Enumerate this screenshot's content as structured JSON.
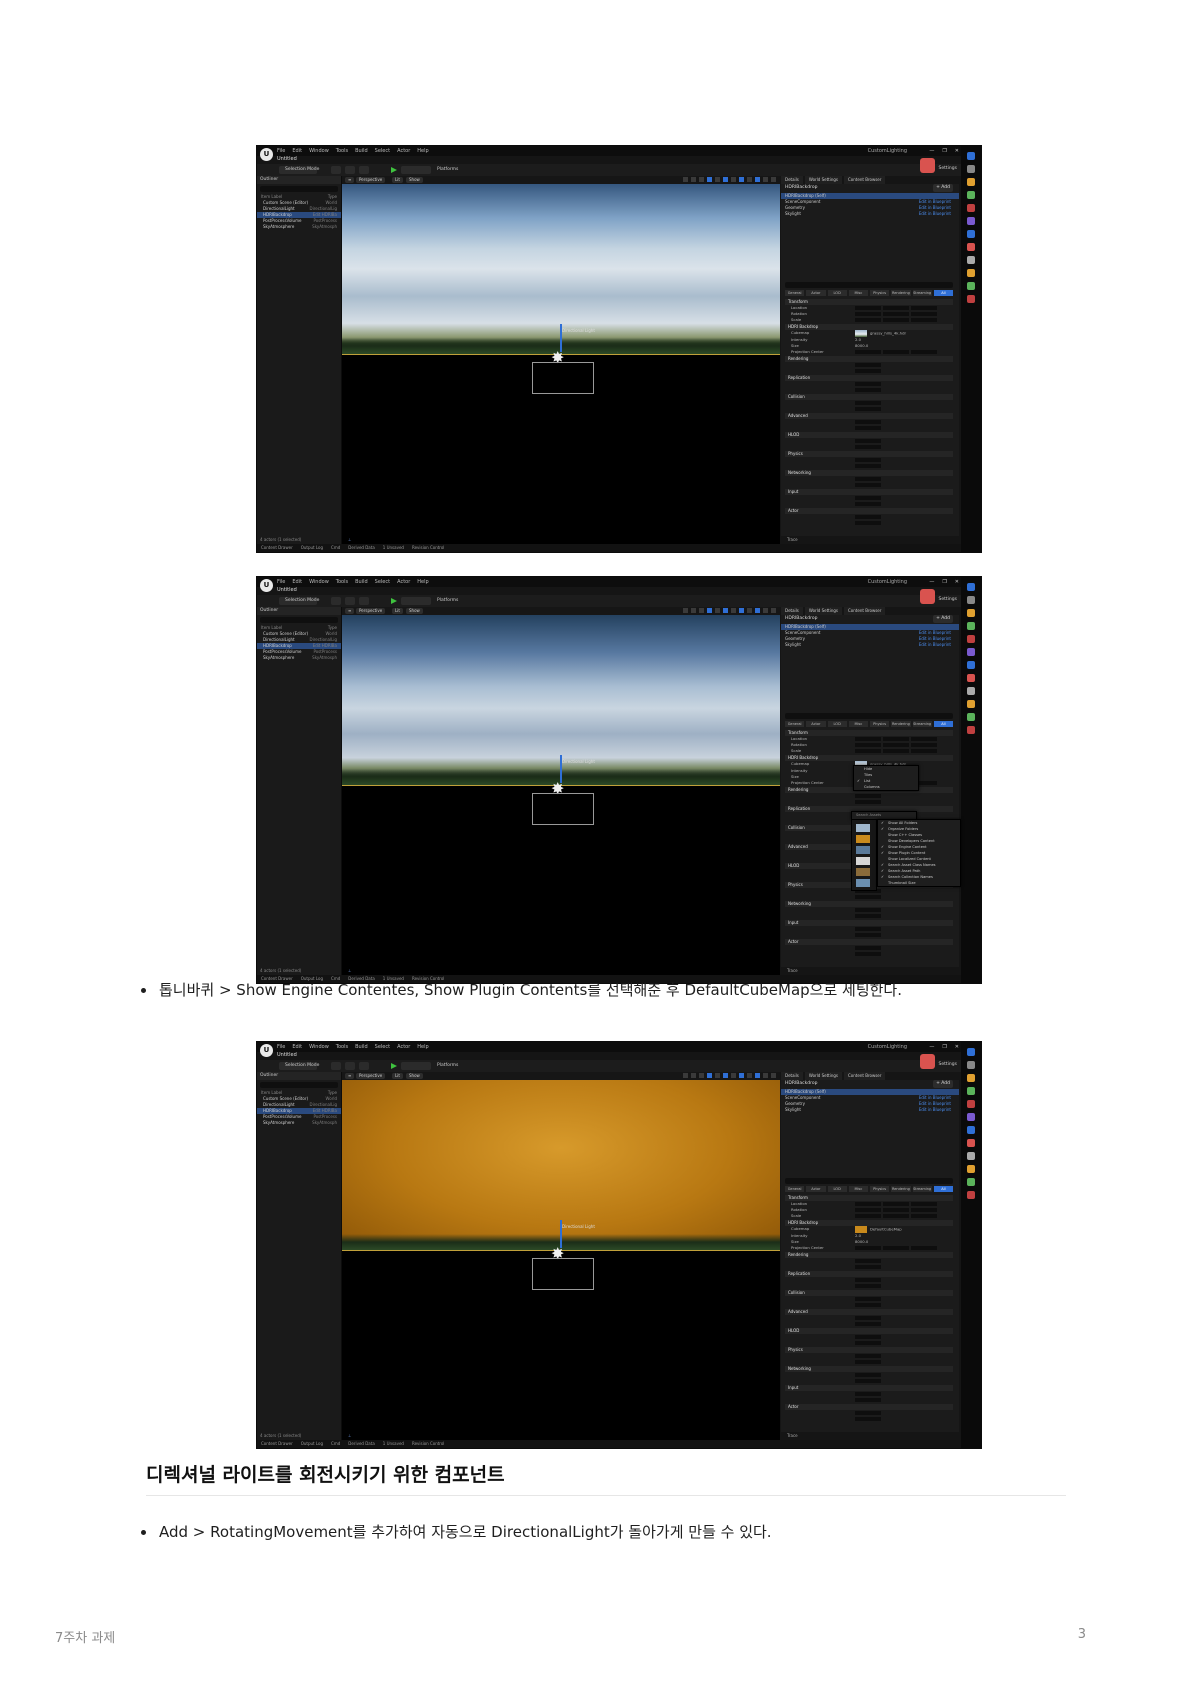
{
  "editor": {
    "menu": [
      "File",
      "Edit",
      "Window",
      "Tools",
      "Build",
      "Select",
      "Actor",
      "Help"
    ],
    "level_name": "Untitled",
    "project_name": "CustomLighting",
    "window_buttons": [
      "—",
      "❐",
      "✕"
    ],
    "toolbar": {
      "selection_mode": "Selection Mode",
      "platforms": "Platforms",
      "settings": "Settings"
    },
    "outliner": {
      "tab": "Outliner",
      "columns": [
        "Item Label",
        "Type"
      ],
      "rows": [
        {
          "label": "Custom Scene (Editor)",
          "type": "World"
        },
        {
          "label": "DirectionalLight",
          "type": "DirectionalLig"
        },
        {
          "label": "HDRIBackdrop",
          "type": "Edit HDRIBa"
        },
        {
          "label": "PostProcessVolume",
          "type": "PostProcess"
        },
        {
          "label": "SkyAtmosphere",
          "type": "SkyAtmosph"
        }
      ],
      "footer": "4 actors (1 selected)"
    },
    "viewport": {
      "perspective": "Perspective",
      "lit": "Lit",
      "show": "Show",
      "gizmo_label": "Directional Light"
    },
    "details": {
      "tabs": [
        "Details",
        "World Settings",
        "Content Browser"
      ],
      "actor": "HDRIBackdrop",
      "add_label": "+ Add",
      "components": [
        {
          "label": "HDRIBackdrop (Self)",
          "edit": ""
        },
        {
          "label": "SceneComponent",
          "edit": "Edit in Blueprint"
        },
        {
          "label": "Geometry",
          "edit": "Edit in Blueprint"
        },
        {
          "label": "Skylight",
          "edit": "Edit in Blueprint"
        }
      ],
      "category_tabs": [
        "General",
        "Actor",
        "LOD",
        "Misc",
        "Physics",
        "Rendering",
        "Streaming",
        "All"
      ],
      "transform": {
        "cat": "Transform",
        "rows": [
          "Location",
          "Rotation",
          "Scale"
        ]
      },
      "hdri": {
        "cat": "HDRI Backdrop",
        "cubemap_label": "Cubemap",
        "cubemap_value_1": "grassy_hills_4k.hdr",
        "cubemap_value_3": "DefaultCubeMap",
        "intensity_label": "Intensity",
        "intensity": "2.0",
        "size_label": "Size",
        "size": "8000.0",
        "projection_center": "Projection Center"
      },
      "sections": [
        "Rendering",
        "Replication",
        "Collision",
        "Advanced",
        "HLOD",
        "Physics",
        "Networking",
        "Input",
        "Actor"
      ],
      "footer": "Trace"
    },
    "status": [
      "Content Drawer",
      "Output Log",
      "Cmd",
      "Derived Data",
      "1 Unsaved",
      "Revision Control"
    ]
  },
  "popup": {
    "filter_menu": [
      "Hide",
      "Tiles",
      "List",
      "Columns"
    ],
    "view_options": [
      "Show All Folders",
      "Organize Folders",
      "Show C++ Classes",
      "Show Developers Content",
      "Show Engine Content",
      "Show Plugin Content",
      "Show Localized Content",
      "Search Asset Class Names",
      "Search Asset Path",
      "Search Collection Names",
      "Thumbnail Size"
    ],
    "checked": [
      "Show All Folders",
      "Organize Folders",
      "Show Engine Content",
      "Show Plugin Content",
      "Search Asset Class Names",
      "Search Asset Path",
      "Search Collection Names"
    ],
    "search_placeholder": "Search Assets"
  },
  "document": {
    "bullet1": "톱니바퀴 > Show Engine Contentes, Show Plugin Contents를 선택해준 후 DefaultCubeMap으로 세팅한다.",
    "heading": "디렉셔널 라이트를 회전시키기 위한 컴포넌트",
    "bullet2": "Add > RotatingMovement를 추가하여 자동으로 DirectionalLight가 돌아가게 만들 수 있다.",
    "footer_left": "7주차 과제",
    "page_number": "3"
  },
  "colors": {
    "selection_blue": "#2a4a7f",
    "accent_blue": "#2f6fd6",
    "play_green": "#3fc33f",
    "cubemap_orange": "#c98a1c"
  }
}
